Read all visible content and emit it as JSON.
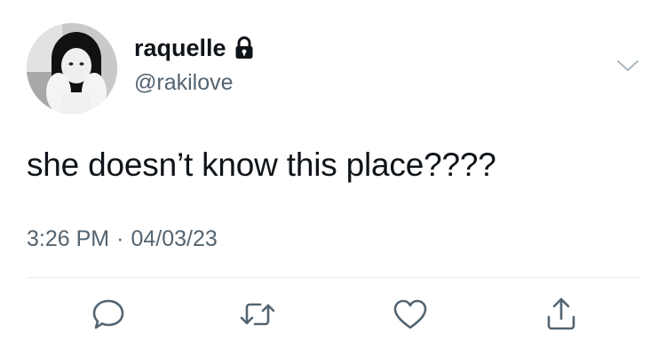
{
  "user": {
    "display_name": "raquelle",
    "handle": "@rakilove",
    "protected_icon": "lock-icon"
  },
  "tweet": {
    "text": "she doesn’t know this place????",
    "time": "3:26 PM",
    "separator": "·",
    "date": "04/03/23"
  },
  "actions": [
    {
      "name": "reply",
      "icon": "speech-bubble-icon"
    },
    {
      "name": "retweet",
      "icon": "retweet-icon"
    },
    {
      "name": "like",
      "icon": "heart-icon"
    },
    {
      "name": "share",
      "icon": "share-icon"
    }
  ],
  "menu": {
    "icon": "chevron-down-icon"
  },
  "colors": {
    "text": "#0f1419",
    "secondary": "#536471",
    "divider": "#e6ecf0",
    "icon": "#536471"
  }
}
